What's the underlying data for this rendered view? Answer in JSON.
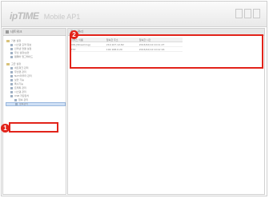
{
  "app": {
    "brand_prefix": "ipTIME",
    "brand_name": "Mobile AP1"
  },
  "left_panel": {
    "title": "네트워크"
  },
  "right_panel": {
    "title": "접속 관리"
  },
  "tree": [
    {
      "label": "기본 설정",
      "level": 0,
      "kind": "folder"
    },
    {
      "label": "시스템 요약 정보",
      "level": 1,
      "kind": "item"
    },
    {
      "label": "인터넷 연결 설정",
      "level": 1,
      "kind": "item"
    },
    {
      "label": "무선 설정/보안",
      "level": 1,
      "kind": "item"
    },
    {
      "label": "펌웨어 업그레이드",
      "level": 1,
      "kind": "item"
    },
    {
      "label": "고급 설정",
      "level": 0,
      "kind": "folder"
    },
    {
      "label": "네트워크 관리",
      "level": 1,
      "kind": "item"
    },
    {
      "label": "무선랜 관리",
      "level": 1,
      "kind": "item"
    },
    {
      "label": "NAT/라우터 관리",
      "level": 1,
      "kind": "item"
    },
    {
      "label": "보안 기능",
      "level": 1,
      "kind": "item"
    },
    {
      "label": "특수기능",
      "level": 1,
      "kind": "item"
    },
    {
      "label": "트래픽 관리",
      "level": 1,
      "kind": "item"
    },
    {
      "label": "시스템 관리",
      "level": 1,
      "kind": "item"
    },
    {
      "label": "USB 저장장치",
      "level": 1,
      "kind": "item"
    },
    {
      "label": "접속 관리",
      "level": 2,
      "kind": "item"
    },
    {
      "label": "접속관리",
      "level": 2,
      "kind": "item",
      "selected": true
    }
  ],
  "table": {
    "headers": [
      "서비스 이름",
      "접속한 주소",
      "접속한 시간"
    ],
    "rows": [
      [
        "URL(Streaming)",
        "210.107.12.82",
        "2013/02/14 10:11:27"
      ],
      [
        "FTP",
        "192.168.0.20",
        "2013/02/14 10:12:16"
      ]
    ]
  },
  "annotations": {
    "badge_1": "1",
    "badge_2": "2",
    "accent_color": "#e2231a"
  }
}
